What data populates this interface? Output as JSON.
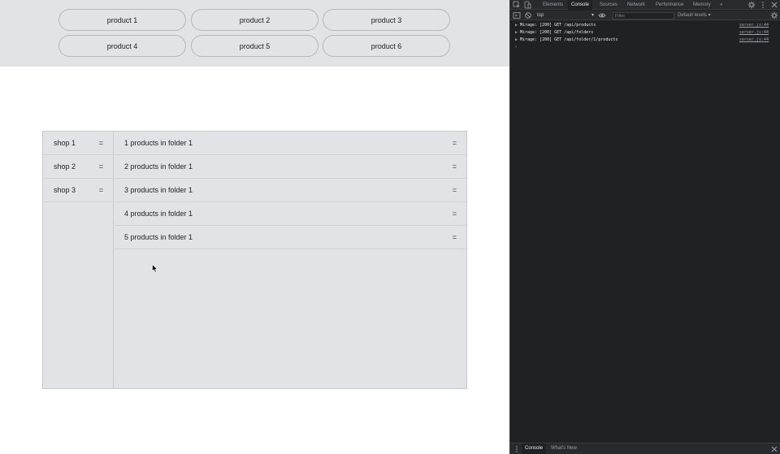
{
  "products": [
    "product 1",
    "product 2",
    "product 3",
    "product 4",
    "product 5",
    "product 6"
  ],
  "shops": [
    {
      "label": "shop 1",
      "handle": "="
    },
    {
      "label": "shop 2",
      "handle": "="
    },
    {
      "label": "shop 3",
      "handle": "="
    }
  ],
  "folder_products": [
    {
      "label": "1 products in folder 1",
      "handle": "="
    },
    {
      "label": "2 products in folder 1",
      "handle": "="
    },
    {
      "label": "3 products in folder 1",
      "handle": "="
    },
    {
      "label": "4 products in folder 1",
      "handle": "="
    },
    {
      "label": "5 products in folder 1",
      "handle": "="
    }
  ],
  "devtools": {
    "tabs": [
      "Elements",
      "Console",
      "Sources",
      "Network",
      "Performance",
      "Memory"
    ],
    "active_tab": "Console",
    "more_tabs": "»",
    "context": "top",
    "filter_placeholder": "Filter",
    "levels": "Default levels ▾",
    "logs": [
      {
        "text": "Mirage: [200] GET /api/products",
        "source": "server.js:44"
      },
      {
        "text": "Mirage: [200] GET /api/folders",
        "source": "server.js:44"
      },
      {
        "text": "Mirage: [200] GET /api/folder/1/products",
        "source": "server.js:44"
      }
    ],
    "drawer_tabs": [
      "Console",
      "What's New"
    ],
    "prompt": "›"
  },
  "colors": {
    "app_bg": "#e2e3e7",
    "devtools_bg": "#202124",
    "accent": "#4a90d9"
  }
}
